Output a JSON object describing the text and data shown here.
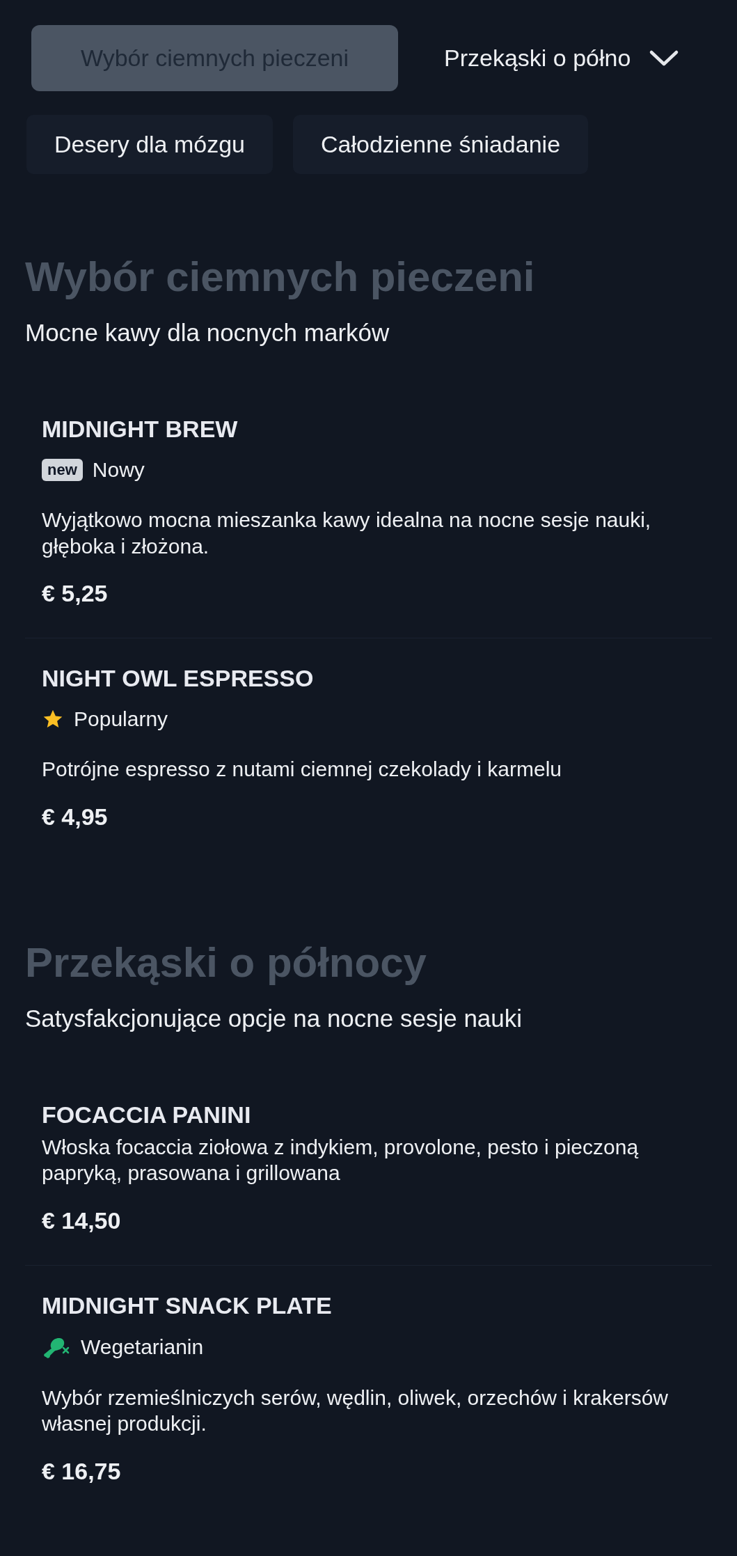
{
  "tabs": [
    {
      "label": "Wybór ciemnych pieczeni",
      "selected": true
    },
    {
      "label": "Przekąski o półno",
      "selected": false
    },
    {
      "label": "Desery dla mózgu",
      "selected": false
    },
    {
      "label": "Całodzienne śniadanie",
      "selected": false
    }
  ],
  "sections": [
    {
      "title": "Wybór ciemnych pieczeni",
      "subtitle": "Mocne kawy dla nocnych marków",
      "items": [
        {
          "name": "MIDNIGHT BREW",
          "badge": {
            "kind": "new",
            "tag": "new",
            "label": "Nowy"
          },
          "description": "Wyjątkowo mocna mieszanka kawy idealna na nocne sesje nauki, głęboka i złożona.",
          "price": "€ 5,25"
        },
        {
          "name": "NIGHT OWL ESPRESSO",
          "badge": {
            "kind": "star",
            "label": "Popularny"
          },
          "description": "Potrójne espresso z nutami ciemnej czekolady i karmelu",
          "price": "€ 4,95"
        }
      ]
    },
    {
      "title": "Przekąski o północy",
      "subtitle": "Satysfakcjonujące opcje na nocne sesje nauki",
      "items": [
        {
          "name": "FOCACCIA PANINI",
          "description": "Włoska focaccia ziołowa z indykiem, provolone, pesto i pieczoną papryką, prasowana i grillowana",
          "price": "€ 14,50"
        },
        {
          "name": "MIDNIGHT SNACK PLATE",
          "badge": {
            "kind": "vegetarian",
            "label": "Wegetarianin"
          },
          "description": "Wybór rzemieślniczych serów, wędlin, oliwek, orzechów i krakersów własnej produkcji.",
          "price": "€ 16,75"
        }
      ]
    }
  ]
}
